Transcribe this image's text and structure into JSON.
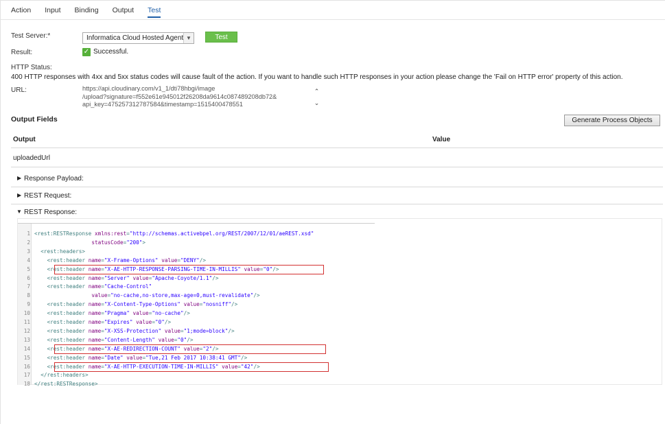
{
  "tabs": [
    "Action",
    "Input",
    "Binding",
    "Output",
    "Test"
  ],
  "active_tab": "Test",
  "form": {
    "test_server_label": "Test Server:*",
    "test_server_value": "Informatica Cloud Hosted Agent",
    "test_button": "Test",
    "result_label": "Result:",
    "result_value": "Successful.",
    "http_status_label": "HTTP Status:",
    "http_status_text": "400  HTTP responses with 4xx and 5xx status codes will cause fault of the action. If you want to handle such HTTP responses in your action please change the 'Fail on HTTP error' property of this action.",
    "url_label": "URL:",
    "url_lines": [
      "https://api.cloudinary.com/v1_1/dti78hbgi/image",
      "/upload?signature=f552e61e945012f26208da9614c087489208db72&",
      "api_key=475257312787584&timestamp=1515400478551"
    ]
  },
  "output_fields": {
    "title": "Output Fields",
    "generate_button": "Generate Process Objects",
    "col_output": "Output",
    "col_value": "Value",
    "rows": [
      {
        "output": "uploadedUrl",
        "value": ""
      }
    ]
  },
  "expanders": {
    "payload": "Response Payload:",
    "request": "REST Request:",
    "response": "REST Response:"
  },
  "code": {
    "lines": [
      {
        "n": "1",
        "html": "<span class=\"tag\">&lt;rest:RESTResponse</span> <span class=\"attr\">xmlns:rest</span>=<span class=\"val\">\"http://schemas.activebpel.org/REST/2007/12/01/aeREST.xsd\"</span>"
      },
      {
        "n": "2",
        "html": "                  <span class=\"attr\">statusCode</span>=<span class=\"val\">\"200\"</span><span class=\"tag\">&gt;</span>"
      },
      {
        "n": "3",
        "html": "  <span class=\"tag\">&lt;rest:headers&gt;</span>"
      },
      {
        "n": "4",
        "html": "    <span class=\"tag\">&lt;rest:header</span> <span class=\"attr\">name</span>=<span class=\"val\">\"X-Frame-Options\"</span> <span class=\"attr\">value</span>=<span class=\"val\">\"DENY\"</span><span class=\"tag\">/&gt;</span>"
      },
      {
        "n": "5",
        "html": "    <span class=\"tag\">&lt;rest:header</span> <span class=\"attr\">name</span>=<span class=\"val\">\"X-AE-HTTP-RESPONSE-PARSING-TIME-IN-MILLIS\"</span> <span class=\"attr\">value</span>=<span class=\"val\">\"0\"</span><span class=\"tag\">/&gt;</span>"
      },
      {
        "n": "6",
        "html": "    <span class=\"tag\">&lt;rest:header</span> <span class=\"attr\">name</span>=<span class=\"val\">\"Server\"</span> <span class=\"attr\">value</span>=<span class=\"val\">\"Apache-Coyote/1.1\"</span><span class=\"tag\">/&gt;</span>"
      },
      {
        "n": "7",
        "html": "    <span class=\"tag\">&lt;rest:header</span> <span class=\"attr\">name</span>=<span class=\"val\">\"Cache-Control\"</span>"
      },
      {
        "n": "8",
        "html": "                  <span class=\"attr\">value</span>=<span class=\"val\">\"no-cache,no-store,max-age=0,must-revalidate\"</span><span class=\"tag\">/&gt;</span>"
      },
      {
        "n": "9",
        "html": "    <span class=\"tag\">&lt;rest:header</span> <span class=\"attr\">name</span>=<span class=\"val\">\"X-Content-Type-Options\"</span> <span class=\"attr\">value</span>=<span class=\"val\">\"nosniff\"</span><span class=\"tag\">/&gt;</span>"
      },
      {
        "n": "10",
        "html": "    <span class=\"tag\">&lt;rest:header</span> <span class=\"attr\">name</span>=<span class=\"val\">\"Pragma\"</span> <span class=\"attr\">value</span>=<span class=\"val\">\"no-cache\"</span><span class=\"tag\">/&gt;</span>"
      },
      {
        "n": "11",
        "html": "    <span class=\"tag\">&lt;rest:header</span> <span class=\"attr\">name</span>=<span class=\"val\">\"Expires\"</span> <span class=\"attr\">value</span>=<span class=\"val\">\"0\"</span><span class=\"tag\">/&gt;</span>"
      },
      {
        "n": "12",
        "html": "    <span class=\"tag\">&lt;rest:header</span> <span class=\"attr\">name</span>=<span class=\"val\">\"X-XSS-Protection\"</span> <span class=\"attr\">value</span>=<span class=\"val\">\"1;mode=block\"</span><span class=\"tag\">/&gt;</span>"
      },
      {
        "n": "13",
        "html": "    <span class=\"tag\">&lt;rest:header</span> <span class=\"attr\">name</span>=<span class=\"val\">\"Content-Length\"</span> <span class=\"attr\">value</span>=<span class=\"val\">\"0\"</span><span class=\"tag\">/&gt;</span>"
      },
      {
        "n": "14",
        "html": "    <span class=\"tag\">&lt;rest:header</span> <span class=\"attr\">name</span>=<span class=\"val\">\"X-AE-REDIRECTION-COUNT\"</span> <span class=\"attr\">value</span>=<span class=\"val\">\"2\"</span><span class=\"tag\">/&gt;</span>"
      },
      {
        "n": "15",
        "html": "    <span class=\"tag\">&lt;rest:header</span> <span class=\"attr\">name</span>=<span class=\"val\">\"Date\"</span> <span class=\"attr\">value</span>=<span class=\"val\">\"Tue,21 Feb 2017 10:38:41 GMT\"</span><span class=\"tag\">/&gt;</span>"
      },
      {
        "n": "16",
        "html": "    <span class=\"tag\">&lt;rest:header</span> <span class=\"attr\">name</span>=<span class=\"val\">\"X-AE-HTTP-EXECUTION-TIME-IN-MILLIS\"</span> <span class=\"attr\">value</span>=<span class=\"val\">\"42\"</span><span class=\"tag\">/&gt;</span>"
      },
      {
        "n": "17",
        "html": "  <span class=\"tag\">&lt;/rest:headers&gt;</span>"
      },
      {
        "n": "18",
        "html": "<span class=\"tag\">&lt;/rest:RESTResponse&gt;</span>"
      }
    ]
  }
}
